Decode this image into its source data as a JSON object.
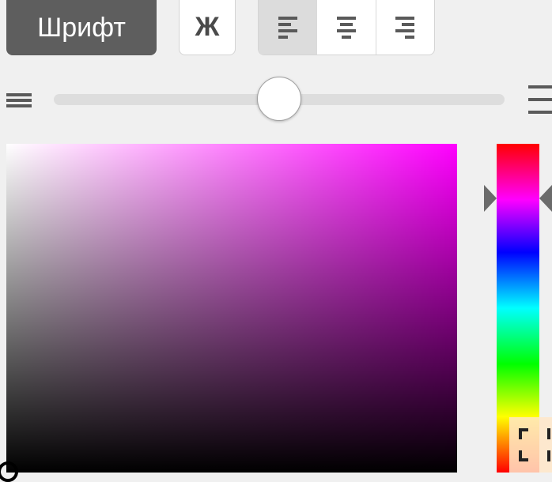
{
  "toolbar": {
    "font_label": "Шрифт",
    "bold_label": "Ж",
    "align_buttons": [
      {
        "name": "align-left",
        "active": true
      },
      {
        "name": "align-center",
        "active": false
      },
      {
        "name": "align-right",
        "active": false
      }
    ]
  },
  "size_slider": {
    "min_icon": "lines-small-icon",
    "max_icon": "lines-large-icon",
    "value_fraction": 0.5
  },
  "color_picker": {
    "hue_color": "#ff00ff",
    "saturation": 0,
    "brightness": 0,
    "hue_fraction": 0.17
  },
  "colors": {
    "font_button_bg": "#5e5e5e",
    "background": "#f0f0f0",
    "slider_track": "#dddddd"
  }
}
